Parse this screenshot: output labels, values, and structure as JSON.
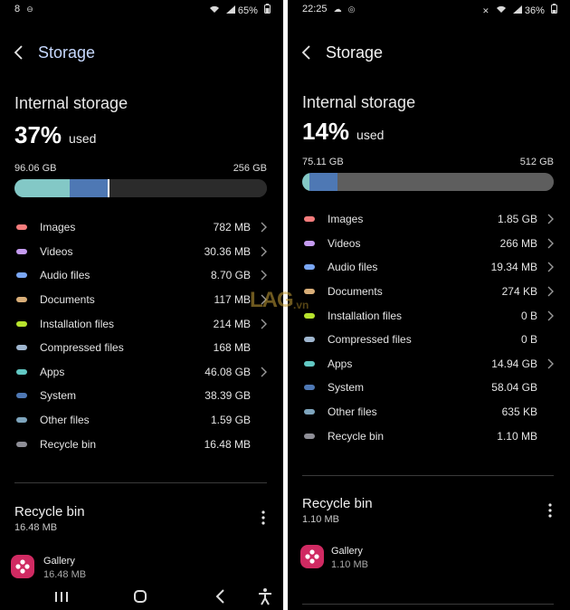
{
  "colors": {
    "images": "#f47c7c",
    "videos": "#c59bf0",
    "audio": "#7aa7f5",
    "documents": "#d9ae78",
    "installation": "#b7e32d",
    "compressed": "#9fb6cf",
    "apps": "#62c9c4",
    "system": "#4e78b4",
    "other": "#7ea5bd",
    "recycle": "#8e8e96",
    "gallery_icon": "#d02a62",
    "bar_track": "#2a2a2a"
  },
  "left": {
    "status": {
      "time": "8",
      "battery": "65%"
    },
    "title": "Storage",
    "section": "Internal storage",
    "percent": "37%",
    "percent_suffix": "used",
    "used": "96.06 GB",
    "total": "256 GB",
    "bar_segments": [
      {
        "name": "apps",
        "fraction": 0.22,
        "color": "#83c8c6"
      },
      {
        "name": "system",
        "fraction": 0.15,
        "color": "#4e78b4"
      },
      {
        "name": "other",
        "fraction": 0.005,
        "color": "#ffffff"
      }
    ],
    "categories": [
      {
        "label": "Images",
        "size": "782 MB",
        "chevron": true,
        "color": "#f47c7c"
      },
      {
        "label": "Videos",
        "size": "30.36 MB",
        "chevron": true,
        "color": "#c59bf0"
      },
      {
        "label": "Audio files",
        "size": "8.70 GB",
        "chevron": true,
        "color": "#7aa7f5"
      },
      {
        "label": "Documents",
        "size": "117 MB",
        "chevron": true,
        "color": "#d9ae78"
      },
      {
        "label": "Installation files",
        "size": "214 MB",
        "chevron": true,
        "color": "#b7e32d"
      },
      {
        "label": "Compressed files",
        "size": "168 MB",
        "chevron": false,
        "color": "#9fb6cf"
      },
      {
        "label": "Apps",
        "size": "46.08 GB",
        "chevron": true,
        "color": "#62c9c4"
      },
      {
        "label": "System",
        "size": "38.39 GB",
        "chevron": false,
        "color": "#4e78b4"
      },
      {
        "label": "Other files",
        "size": "1.59 GB",
        "chevron": false,
        "color": "#7ea5bd"
      },
      {
        "label": "Recycle bin",
        "size": "16.48 MB",
        "chevron": false,
        "color": "#8e8e96"
      }
    ],
    "recycle_bin": {
      "title": "Recycle bin",
      "size": "16.48 MB"
    },
    "gallery": {
      "name": "Gallery",
      "size": "16.48 MB"
    }
  },
  "right": {
    "status": {
      "time": "22:25",
      "battery": "36%"
    },
    "title": "Storage",
    "section": "Internal storage",
    "percent": "14%",
    "percent_suffix": "used",
    "used": "75.11 GB",
    "total": "512 GB",
    "bar_segments": [
      {
        "name": "apps",
        "fraction": 0.03,
        "color": "#83c8c6"
      },
      {
        "name": "system",
        "fraction": 0.11,
        "color": "#4e78b4"
      }
    ],
    "categories": [
      {
        "label": "Images",
        "size": "1.85 GB",
        "chevron": true,
        "color": "#f47c7c"
      },
      {
        "label": "Videos",
        "size": "266 MB",
        "chevron": true,
        "color": "#c59bf0"
      },
      {
        "label": "Audio files",
        "size": "19.34 MB",
        "chevron": true,
        "color": "#7aa7f5"
      },
      {
        "label": "Documents",
        "size": "274 KB",
        "chevron": true,
        "color": "#d9ae78"
      },
      {
        "label": "Installation files",
        "size": "0 B",
        "chevron": true,
        "color": "#b7e32d"
      },
      {
        "label": "Compressed files",
        "size": "0 B",
        "chevron": false,
        "color": "#9fb6cf"
      },
      {
        "label": "Apps",
        "size": "14.94 GB",
        "chevron": true,
        "color": "#62c9c4"
      },
      {
        "label": "System",
        "size": "58.04 GB",
        "chevron": false,
        "color": "#4e78b4"
      },
      {
        "label": "Other files",
        "size": "635 KB",
        "chevron": false,
        "color": "#7ea5bd"
      },
      {
        "label": "Recycle bin",
        "size": "1.10 MB",
        "chevron": false,
        "color": "#8e8e96"
      }
    ],
    "recycle_bin": {
      "title": "Recycle bin",
      "size": "1.10 MB"
    },
    "gallery": {
      "name": "Gallery",
      "size": "1.10 MB"
    }
  },
  "watermark": {
    "text": "LAG",
    "sub": ".vn"
  }
}
